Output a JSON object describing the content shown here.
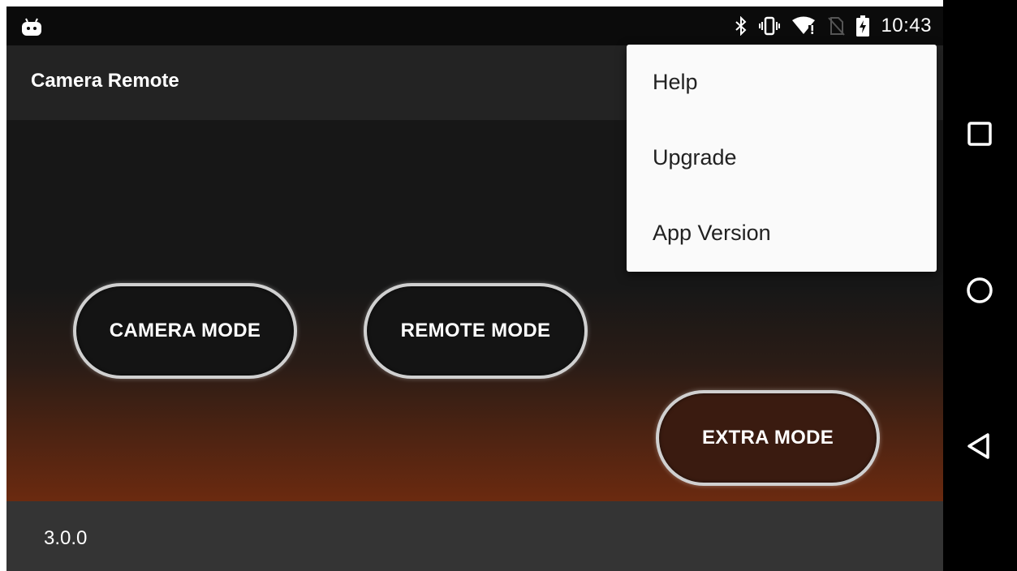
{
  "status_bar": {
    "time": "10:43",
    "icons": [
      "android-debug-icon",
      "bluetooth-icon",
      "vibrate-icon",
      "wifi-alert-icon",
      "no-sim-icon",
      "battery-charging-icon"
    ]
  },
  "app_bar": {
    "title": "Camera Remote"
  },
  "main": {
    "buttons": [
      {
        "label": "CAMERA MODE"
      },
      {
        "label": "REMOTE MODE"
      },
      {
        "label": "EXTRA MODE"
      }
    ]
  },
  "footer": {
    "version": "3.0.0"
  },
  "overflow_menu": {
    "items": [
      {
        "label": "Help"
      },
      {
        "label": "Upgrade"
      },
      {
        "label": "App Version"
      }
    ]
  },
  "nav_bar": {
    "icons": [
      "recents-icon",
      "home-icon",
      "back-icon"
    ]
  },
  "colors": {
    "status_bar": "#0b0b0b",
    "app_bar": "#232323",
    "background": "#171717",
    "gradient_bottom": "#6b2a10",
    "footer": "#343434",
    "menu_background": "#fafafa",
    "menu_text": "#212121",
    "button_border": "#d0d0d0"
  }
}
